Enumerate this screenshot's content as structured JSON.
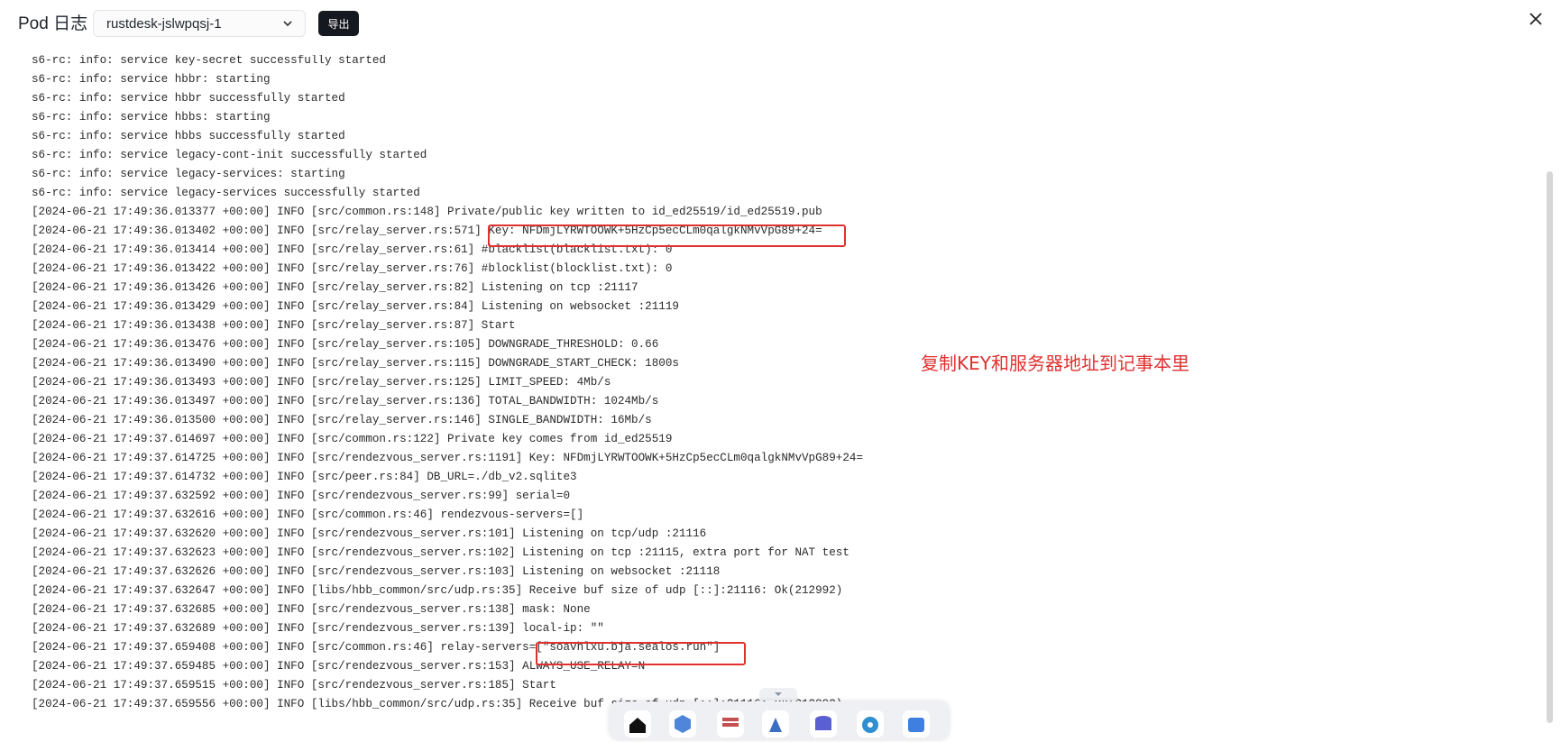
{
  "header": {
    "title": "Pod 日志",
    "pod_select_value": "rustdesk-jslwpqsj-1",
    "export_label": "导出"
  },
  "log_lines": [
    "s6-rc: info: service key-secret successfully started",
    "s6-rc: info: service hbbr: starting",
    "s6-rc: info: service hbbr successfully started",
    "s6-rc: info: service hbbs: starting",
    "s6-rc: info: service hbbs successfully started",
    "s6-rc: info: service legacy-cont-init successfully started",
    "s6-rc: info: service legacy-services: starting",
    "s6-rc: info: service legacy-services successfully started",
    "[2024-06-21 17:49:36.013377 +00:00] INFO [src/common.rs:148] Private/public key written to id_ed25519/id_ed25519.pub",
    "[2024-06-21 17:49:36.013402 +00:00] INFO [src/relay_server.rs:571] Key: NFDmjLYRWTOOWK+5HzCp5ecCLm0qalgkNMvVpG89+24=",
    "[2024-06-21 17:49:36.013414 +00:00] INFO [src/relay_server.rs:61] #blacklist(blacklist.txt): 0",
    "[2024-06-21 17:49:36.013422 +00:00] INFO [src/relay_server.rs:76] #blocklist(blocklist.txt): 0",
    "[2024-06-21 17:49:36.013426 +00:00] INFO [src/relay_server.rs:82] Listening on tcp :21117",
    "[2024-06-21 17:49:36.013429 +00:00] INFO [src/relay_server.rs:84] Listening on websocket :21119",
    "[2024-06-21 17:49:36.013438 +00:00] INFO [src/relay_server.rs:87] Start",
    "[2024-06-21 17:49:36.013476 +00:00] INFO [src/relay_server.rs:105] DOWNGRADE_THRESHOLD: 0.66",
    "[2024-06-21 17:49:36.013490 +00:00] INFO [src/relay_server.rs:115] DOWNGRADE_START_CHECK: 1800s",
    "[2024-06-21 17:49:36.013493 +00:00] INFO [src/relay_server.rs:125] LIMIT_SPEED: 4Mb/s",
    "[2024-06-21 17:49:36.013497 +00:00] INFO [src/relay_server.rs:136] TOTAL_BANDWIDTH: 1024Mb/s",
    "[2024-06-21 17:49:36.013500 +00:00] INFO [src/relay_server.rs:146] SINGLE_BANDWIDTH: 16Mb/s",
    "[2024-06-21 17:49:37.614697 +00:00] INFO [src/common.rs:122] Private key comes from id_ed25519",
    "[2024-06-21 17:49:37.614725 +00:00] INFO [src/rendezvous_server.rs:1191] Key: NFDmjLYRWTOOWK+5HzCp5ecCLm0qalgkNMvVpG89+24=",
    "[2024-06-21 17:49:37.614732 +00:00] INFO [src/peer.rs:84] DB_URL=./db_v2.sqlite3",
    "[2024-06-21 17:49:37.632592 +00:00] INFO [src/rendezvous_server.rs:99] serial=0",
    "[2024-06-21 17:49:37.632616 +00:00] INFO [src/common.rs:46] rendezvous-servers=[]",
    "[2024-06-21 17:49:37.632620 +00:00] INFO [src/rendezvous_server.rs:101] Listening on tcp/udp :21116",
    "[2024-06-21 17:49:37.632623 +00:00] INFO [src/rendezvous_server.rs:102] Listening on tcp :21115, extra port for NAT test",
    "[2024-06-21 17:49:37.632626 +00:00] INFO [src/rendezvous_server.rs:103] Listening on websocket :21118",
    "[2024-06-21 17:49:37.632647 +00:00] INFO [libs/hbb_common/src/udp.rs:35] Receive buf size of udp [::]:21116: Ok(212992)",
    "[2024-06-21 17:49:37.632685 +00:00] INFO [src/rendezvous_server.rs:138] mask: None",
    "[2024-06-21 17:49:37.632689 +00:00] INFO [src/rendezvous_server.rs:139] local-ip: \"\"",
    "[2024-06-21 17:49:37.659408 +00:00] INFO [src/common.rs:46] relay-servers=[\"soavhlxu.bja.sealos.run\"]",
    "[2024-06-21 17:49:37.659485 +00:00] INFO [src/rendezvous_server.rs:153] ALWAYS_USE_RELAY=N",
    "[2024-06-21 17:49:37.659515 +00:00] INFO [src/rendezvous_server.rs:185] Start",
    "[2024-06-21 17:49:37.659556 +00:00] INFO [libs/hbb_common/src/udp.rs:35] Receive buf size of udp [::]:21116: Ok(212992)"
  ],
  "annotation": "复制KEY和服务器地址到记事本里",
  "icons": {
    "close": "close-icon",
    "chevron": "chevron-down-icon"
  },
  "colors": {
    "highlight": "#e03131",
    "export_button": "#14181f"
  }
}
